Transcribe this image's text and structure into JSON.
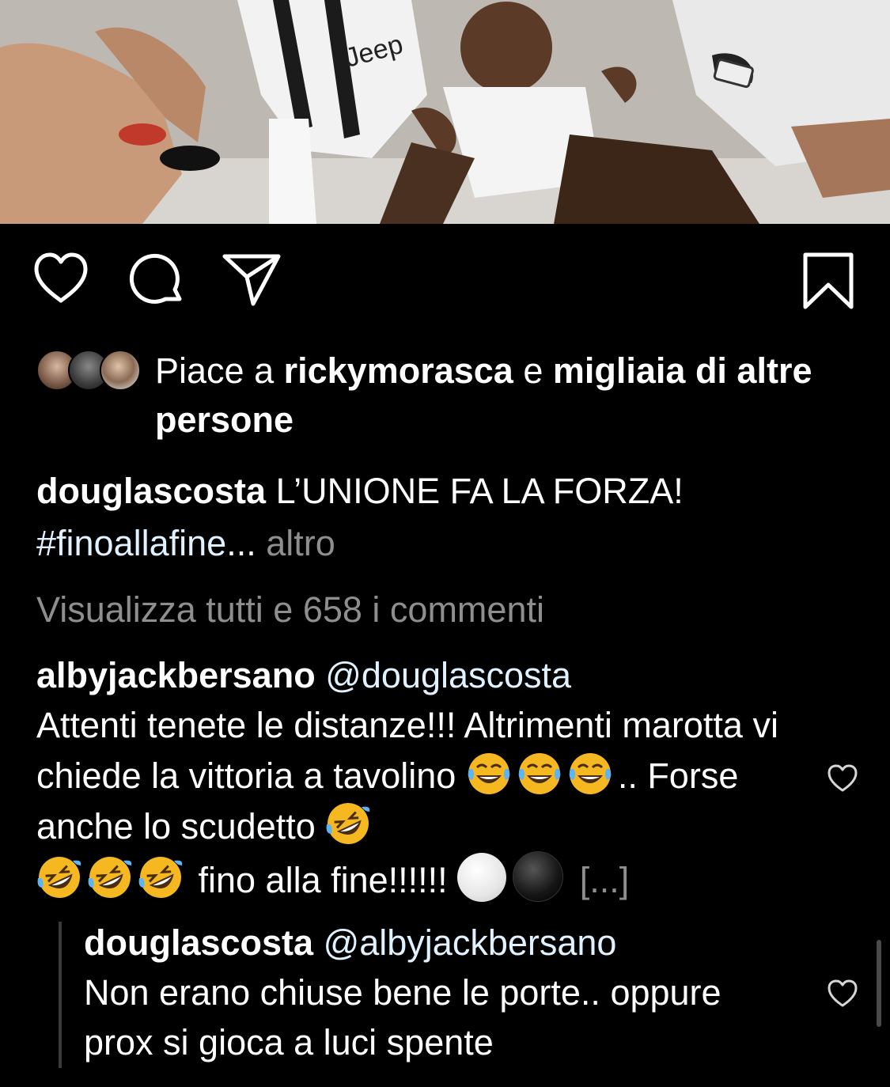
{
  "post": {
    "photo_alt": "team-celebration-photo",
    "jersey_text": "Jeep"
  },
  "actions": {
    "like_icon": "heart-outline-icon",
    "comment_icon": "comment-bubble-icon",
    "share_icon": "paper-plane-icon",
    "save_icon": "bookmark-icon"
  },
  "likes": {
    "prefix": "Piace a ",
    "user": "rickymorasca",
    "middle": " e ",
    "rest": "migliaia di altre persone"
  },
  "caption": {
    "username": "douglascosta",
    "text": " L’UNIONE FA LA FORZA!",
    "hashtag": "#finoallafine",
    "ellipsis": "... ",
    "more": "altro"
  },
  "view_all_comments": "Visualizza tutti e 658 i commenti",
  "comment": {
    "username": "albyjackbersano",
    "mention": "@douglascosta",
    "line1": "Attenti tenete le distanze!!! Altrimenti marotta vi chiede la vittoria a tavolino ",
    "part2": ".. Forse anche lo scudetto ",
    "part3": " fino alla fine!!!!!! ",
    "truncated": "[...]"
  },
  "reply": {
    "username": "douglascosta",
    "mention": "@albyjackbersano",
    "text": "Non erano chiuse bene le porte.. oppure prox si gioca a luci spente"
  },
  "colors": {
    "background": "#000000",
    "muted": "#8e8e8e",
    "link": "#e0f1ff"
  }
}
